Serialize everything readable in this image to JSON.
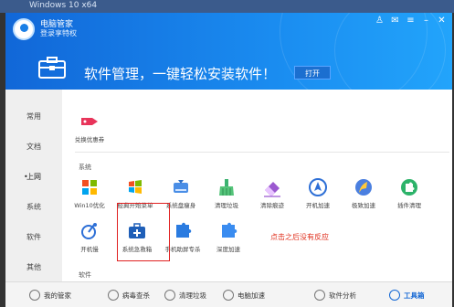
{
  "top_strip": {
    "text": "Windows 10 x64"
  },
  "header": {
    "app_title": "电脑管家",
    "login_link": "登录享特权",
    "banner_text": "软件管理，一键轻松安装软件！",
    "banner_button": "打开"
  },
  "sidebar": {
    "items": [
      {
        "label": "常用"
      },
      {
        "label": "文档"
      },
      {
        "label": "上网",
        "active": true
      },
      {
        "label": "系统"
      },
      {
        "label": "软件"
      },
      {
        "label": "其他"
      }
    ]
  },
  "content": {
    "top_tool": {
      "label": "兑换优惠券"
    },
    "system_section_label": "系统",
    "system_tools_row1": [
      {
        "label": "Win10优化",
        "icon": "windows-icon"
      },
      {
        "label": "经典开始菜单",
        "icon": "start-menu-icon"
      },
      {
        "label": "系统盘瘦身",
        "icon": "disk-icon"
      },
      {
        "label": "清理垃圾",
        "icon": "broom-icon"
      },
      {
        "label": "清除痕迹",
        "icon": "eraser-icon"
      },
      {
        "label": "开机加速",
        "icon": "rocket-icon"
      },
      {
        "label": "极致加速",
        "icon": "feather-icon"
      },
      {
        "label": "插件清理",
        "icon": "puzzle-icon"
      }
    ],
    "system_tools_row2": [
      {
        "label": "开机慢",
        "icon": "boot-icon"
      },
      {
        "label": "系统急救箱",
        "icon": "first-aid-kit-icon"
      },
      {
        "label": "手机助屏专杀",
        "icon": "puzzle-blue-icon"
      },
      {
        "label": "深度加速",
        "icon": "puzzle-blue2-icon"
      }
    ],
    "software_section_label": "软件",
    "annotation": "点击之后没有反应"
  },
  "bottom_bar": {
    "items": [
      {
        "label": "我的管家"
      },
      {
        "label": "病毒查杀"
      },
      {
        "label": "清理垃圾"
      },
      {
        "label": "电脑加速"
      },
      {
        "label": "软件分析"
      },
      {
        "label": "工具箱",
        "active": true
      }
    ]
  },
  "colors": {
    "header_blue": "#1a8cf0",
    "accent_red": "#e02020",
    "active_blue": "#1266d4"
  }
}
